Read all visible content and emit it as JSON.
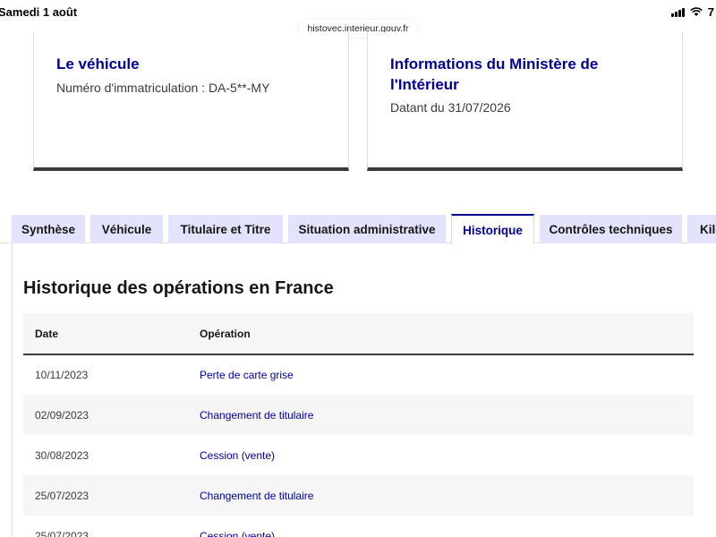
{
  "status_bar": {
    "date": "Samedi 1 août",
    "battery": "7",
    "icons": [
      "signal-icon",
      "wifi-icon"
    ]
  },
  "browser": {
    "url": "histovec.interieur.gouv.fr"
  },
  "cards": {
    "vehicle": {
      "title": "Le véhicule",
      "text": "Numéro d'immatriculation : DA-5**-MY"
    },
    "ministry": {
      "title": "Informations du Ministère de l'Intérieur",
      "text": "Datant du 31/07/2026"
    }
  },
  "tabs": [
    {
      "label": "Synthèse",
      "active": false
    },
    {
      "label": "Véhicule",
      "active": false
    },
    {
      "label": "Titulaire et Titre",
      "active": false
    },
    {
      "label": "Situation administrative",
      "active": false
    },
    {
      "label": "Historique",
      "active": true
    },
    {
      "label": "Contrôles techniques",
      "active": false
    },
    {
      "label": "Kilo",
      "active": false
    }
  ],
  "history": {
    "title": "Historique des opérations en France",
    "columns": [
      "Date",
      "Opération"
    ],
    "rows": [
      {
        "date": "10/11/2023",
        "operation": "Perte de carte grise"
      },
      {
        "date": "02/09/2023",
        "operation": "Changement de titulaire"
      },
      {
        "date": "30/08/2023",
        "operation": "Cession (vente)"
      },
      {
        "date": "25/07/2023",
        "operation": "Changement de titulaire"
      },
      {
        "date": "25/07/2023",
        "operation": "Cession (vente)"
      }
    ]
  },
  "colors": {
    "primary_blue": "#000091",
    "tab_background": "#e3e3fd",
    "row_alt": "#f6f6f6",
    "text": "#161616"
  }
}
